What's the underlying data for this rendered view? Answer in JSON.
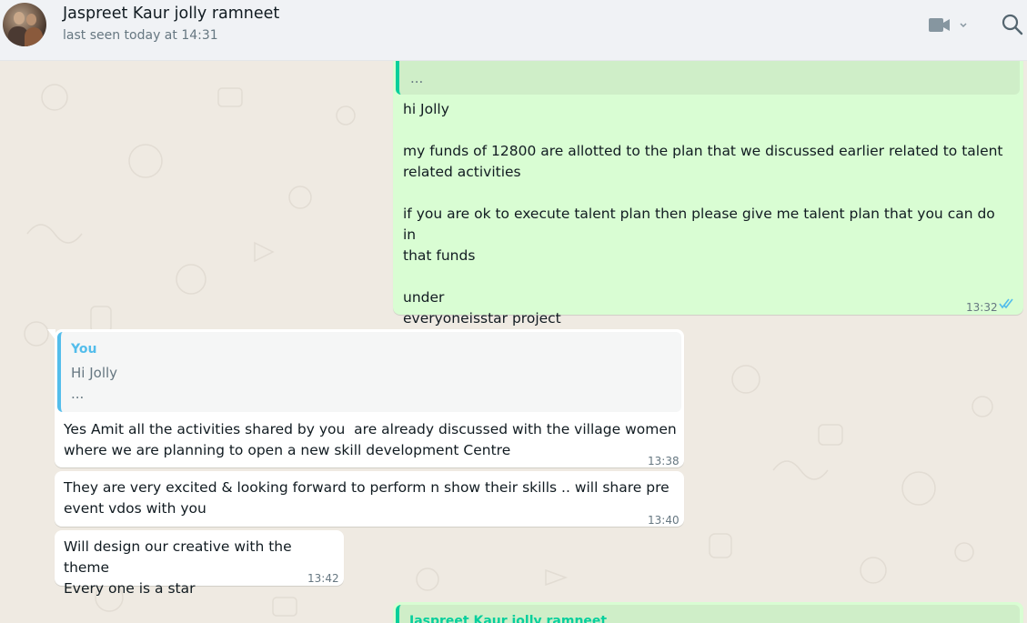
{
  "header": {
    "contact_name": "Jaspreet Kaur jolly ramneet",
    "status": "last seen today at 14:31",
    "icons": [
      "avatar",
      "video-call-icon",
      "chevron-down-icon",
      "search-icon"
    ]
  },
  "colors": {
    "header_bg": "#f0f2f5",
    "chat_bg": "#efeae2",
    "outgoing_bubble": "#d9fdd3",
    "incoming_bubble": "#ffffff",
    "quote_bar_green": "#06cf9c",
    "quote_bar_blue": "#53bdeb",
    "read_tick": "#53bdeb"
  },
  "messages": [
    {
      "direction": "outgoing",
      "quote_text": "...",
      "text": "hi Jolly\n\nmy funds of 12800 are allotted to the plan that we discussed earlier related to talent\nrelated activities\n\nif you are ok to execute talent plan then please give me talent plan that you can do in\nthat funds\n\nunder\neveryoneisstar project",
      "time": "13:32",
      "status_icon": "double-check-read-icon"
    },
    {
      "direction": "incoming",
      "quote_author": "You",
      "quote_line1": "Hi Jolly",
      "quote_line2": "...",
      "text": "Yes Amit all the activities shared by you  are already discussed with the village women\nwhere we are planning to open a new skill development Centre",
      "time": "13:38"
    },
    {
      "direction": "incoming",
      "text": "They are very excited & looking forward to perform n show their skills .. will share pre\nevent vdos with you",
      "time": "13:40"
    },
    {
      "direction": "incoming",
      "text": "Will design our creative with the theme\nEvery one is a star",
      "time": "13:42"
    },
    {
      "direction": "outgoing",
      "quote_author": "Jaspreet Kaur jolly ramneet"
    }
  ]
}
